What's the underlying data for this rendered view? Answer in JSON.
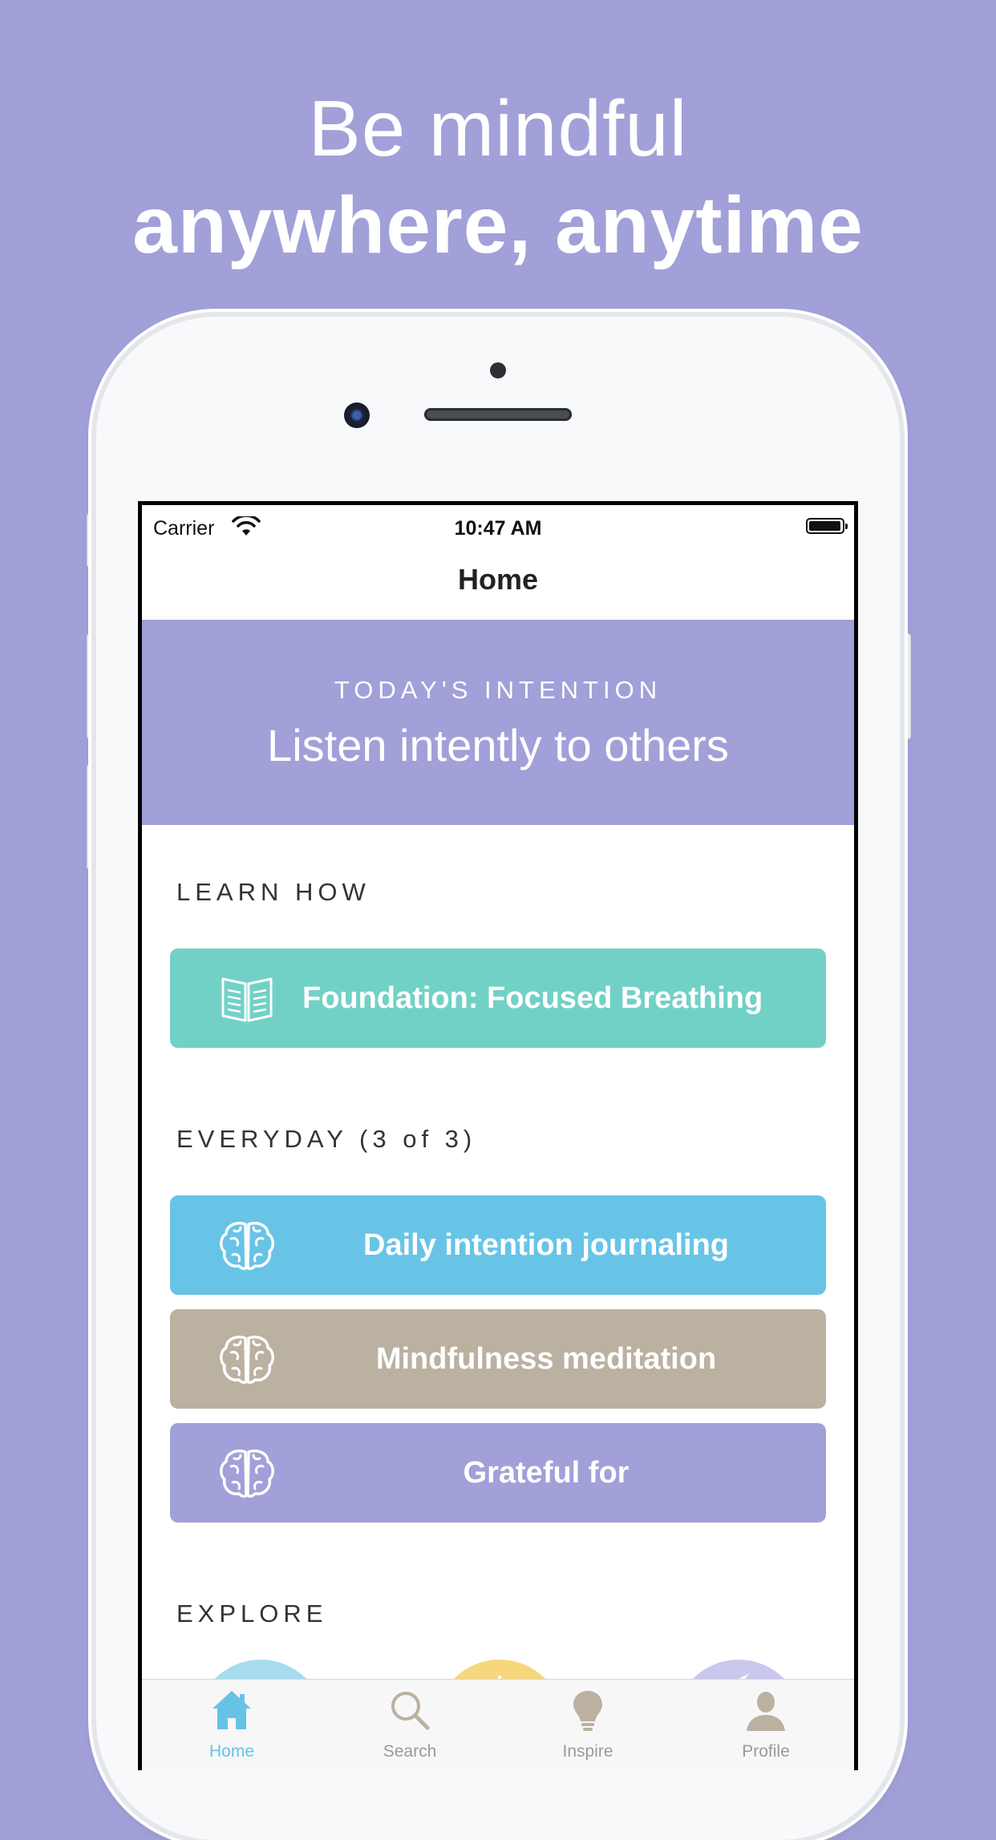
{
  "headline": {
    "line1": "Be mindful",
    "line2": "anywhere, anytime"
  },
  "status_bar": {
    "carrier": "Carrier",
    "time": "10:47 AM"
  },
  "nav": {
    "title": "Home"
  },
  "intention": {
    "eyebrow": "TODAY'S INTENTION",
    "text": "Listen intently to others"
  },
  "learn_how": {
    "label": "LEARN HOW",
    "item": {
      "label": "Foundation: Focused Breathing",
      "icon": "book-icon",
      "color": "#72d1c6"
    }
  },
  "everyday": {
    "label": "EVERYDAY (3 of 3)",
    "items": [
      {
        "label": "Daily intention journaling",
        "icon": "brain-icon",
        "color": "#68c4e6"
      },
      {
        "label": "Mindfulness meditation",
        "icon": "brain-icon",
        "color": "#bab1a1"
      },
      {
        "label": "Grateful for",
        "icon": "brain-icon",
        "color": "#a1a0d8"
      }
    ]
  },
  "explore": {
    "label": "EXPLORE"
  },
  "tabbar": {
    "tabs": [
      {
        "label": "Home",
        "icon": "home-icon",
        "active": true
      },
      {
        "label": "Search",
        "icon": "search-icon",
        "active": false
      },
      {
        "label": "Inspire",
        "icon": "lightbulb-icon",
        "active": false
      },
      {
        "label": "Profile",
        "icon": "profile-icon",
        "active": false
      }
    ]
  },
  "colors": {
    "background": "#a1a0d8",
    "accent": "#66c3e6",
    "teal": "#72d1c6",
    "taupe": "#bab1a1"
  }
}
